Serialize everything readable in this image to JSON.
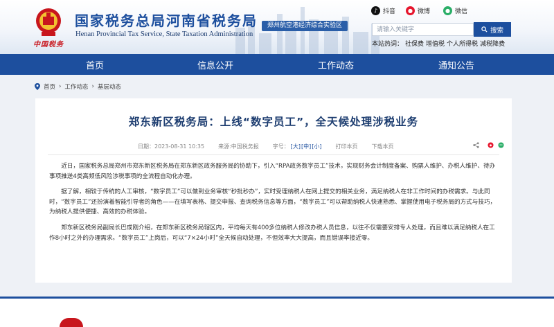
{
  "header": {
    "title": "国家税务总局河南省税务局",
    "subtitle": "Henan Provincial Tax Service, State Taxation Administration",
    "brand_script": "中国税务",
    "zone_badge": "郑州航空港经济综合实验区",
    "social": [
      {
        "label": "抖音",
        "icon": "douyin-icon",
        "color": "#111111"
      },
      {
        "label": "微博",
        "icon": "weibo-icon",
        "color": "#e6162d"
      },
      {
        "label": "微信",
        "icon": "wechat-icon",
        "color": "#2aae67"
      }
    ],
    "search": {
      "placeholder": "请输入关键字",
      "button_label": "搜索"
    },
    "hotwords_label": "本站热词：",
    "hotwords": [
      "社保费",
      "增值税",
      "个人所得税",
      "减税降费"
    ]
  },
  "nav": {
    "items": [
      "首页",
      "信息公开",
      "工作动态",
      "通知公告"
    ]
  },
  "breadcrumb": [
    "首页",
    "工作动态",
    "基层动态"
  ],
  "article": {
    "title": "郑东新区税务局：上线“数字员工”，全天候处理涉税业务",
    "date": "日期：2023-08-31 10:35",
    "source": "来源:中国税务报",
    "font_size_label": "字号：",
    "font_size_options": [
      "[大]",
      "[中]",
      "[小]"
    ],
    "print_label": "打印本页",
    "download_label": "下载本页",
    "paragraphs": [
      "近日，国家税务总局郑州市郑东新区税务局在郑东新区政务服务局的协助下，引入“RPA政务数字员工”技术，实现财务会计制度备案、购票人维护、办税人维护、待办事项推送4类高频低风险涉税事项的全流程自动化办理。",
      "据了解，相较于传统的人工审核，“数字员工”可以做到业务审核“秒批秒办”，实时受理纳税人在网上提交的相关业务，满足纳税人在非工作时间的办税需求。与此同时，“数字员工”还扮演着智能引导者的角色——在填写表格、提交申报、查询税务信息等方面，“数字员工”可以帮助纳税人快速熟悉、掌握使用电子税务局的方式与技巧，为纳税人提供便捷、高效的办税体验。",
      "郑东新区税务局副局长巴成刚介绍，在郑东新区税务局辖区内，平均每天有400多位纳税人修改办税人员信息，以往不仅需要安排专人处理，而且难以满足纳税人在工作8小时之外的办理需求。“数字员工”上岗后，可以“7×24小时”全天候自动处理，不但效率大大提高，而且错误率接近零。"
    ]
  },
  "colors": {
    "primary": "#1d4f9e",
    "brand_red": "#c8161d"
  }
}
